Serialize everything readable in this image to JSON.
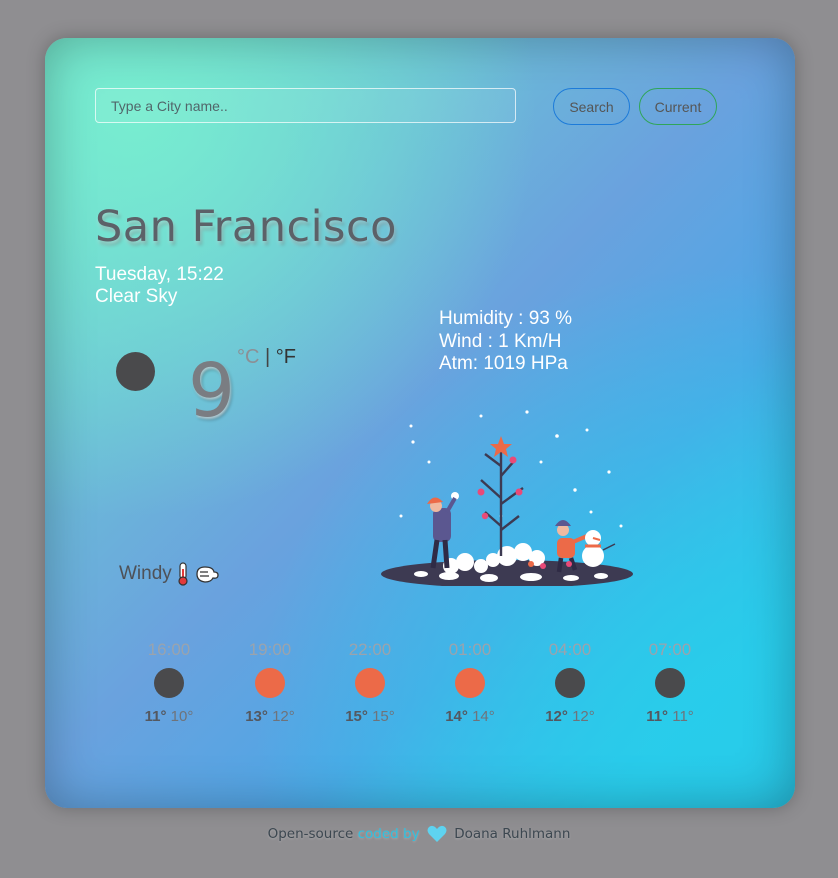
{
  "search": {
    "placeholder": "Type a City name.."
  },
  "buttons": {
    "search": "Search",
    "current": "Current"
  },
  "weather": {
    "city": "San Francisco",
    "datetime": "Tuesday, 15:22",
    "description": "Clear Sky",
    "temperature": "9",
    "unit_c": "°C",
    "unit_sep": "|",
    "unit_f": "°F",
    "humidity": "Humidity : 93 %",
    "wind": "Wind : 1 Km/H",
    "atm": "Atm: 1019 HPa",
    "condition_note": "Windy",
    "icon": "weather-icon"
  },
  "forecast": [
    {
      "time": "16:00",
      "max": "11°",
      "min": "10°",
      "color": "#4a4a4c"
    },
    {
      "time": "19:00",
      "max": "13°",
      "min": "12°",
      "color": "#ec6a48"
    },
    {
      "time": "22:00",
      "max": "15°",
      "min": "15°",
      "color": "#ec6a48"
    },
    {
      "time": "01:00",
      "max": "14°",
      "min": "14°",
      "color": "#ec6a48"
    },
    {
      "time": "04:00",
      "max": "12°",
      "min": "12°",
      "color": "#4a4a4c"
    },
    {
      "time": "07:00",
      "max": "11°",
      "min": "11°",
      "color": "#4a4a4c"
    }
  ],
  "footer": {
    "open_source": "Open-source",
    "coded_by": "coded by",
    "author": "Doana Ruhlmann"
  },
  "colors": {
    "accent_search": "#1d7bd9",
    "accent_current": "#30a559",
    "heart": "#5ed3f0"
  }
}
